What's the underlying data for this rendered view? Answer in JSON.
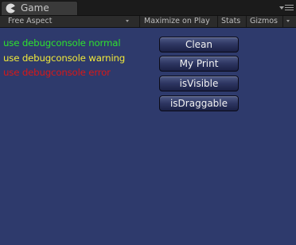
{
  "tab": {
    "icon": "pacman-icon",
    "label": "Game"
  },
  "toolbar": {
    "aspect": "Free Aspect",
    "maximize": "Maximize on Play",
    "stats": "Stats",
    "gizmos": "Gizmos"
  },
  "logs": {
    "normal": "use debugconsole normal",
    "warning": "use debugconsole warning",
    "error": "use debugconsole error"
  },
  "buttons": {
    "clean": "Clean",
    "my_print": "My Print",
    "is_visible": "isVisible",
    "is_draggable": "isDraggable"
  },
  "colors": {
    "game_background": "#2e3a6c",
    "log_normal": "#2ee02e",
    "log_warning": "#f0e83a",
    "log_error": "#d81818"
  }
}
